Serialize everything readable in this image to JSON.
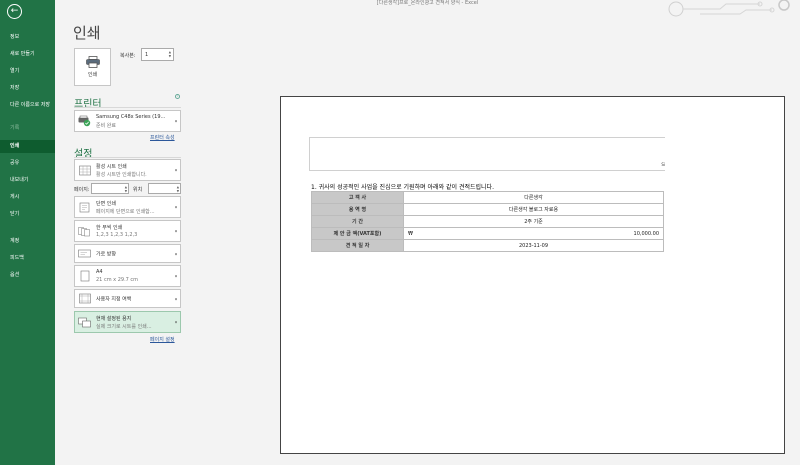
{
  "window": {
    "title": "[다른생각]프로_온라인광고 견적서 양식 - Excel"
  },
  "sidebar": {
    "items": [
      {
        "label": "정보",
        "state": "normal"
      },
      {
        "label": "새로 만들기",
        "state": "normal"
      },
      {
        "label": "열기",
        "state": "normal"
      },
      {
        "label": "저장",
        "state": "normal"
      },
      {
        "label": "다른 이름으로 저장",
        "state": "normal"
      },
      {
        "label": "기록",
        "state": "disabled"
      },
      {
        "label": "인쇄",
        "state": "active"
      },
      {
        "label": "공유",
        "state": "normal"
      },
      {
        "label": "내보내기",
        "state": "normal"
      },
      {
        "label": "게시",
        "state": "normal"
      },
      {
        "label": "닫기",
        "state": "normal"
      },
      {
        "label": "계정",
        "state": "normal"
      },
      {
        "label": "피드백",
        "state": "normal"
      },
      {
        "label": "옵션",
        "state": "normal"
      }
    ]
  },
  "print": {
    "title": "인쇄",
    "button_label": "인쇄",
    "copies_label": "복사본:",
    "copies_value": "1"
  },
  "printer": {
    "heading": "프린터",
    "name": "Samsung C48x Series (19...",
    "status": "준비 완료",
    "properties_link": "프린터 속성"
  },
  "settings": {
    "heading": "설정",
    "active_sheet": {
      "line1": "활성 시트 인쇄",
      "line2": "활성 시트만 인쇄합니다."
    },
    "pages_label": "페이지:",
    "to_label": "위치",
    "single_side": {
      "line1": "단면 인쇄",
      "line2": "페이지에 단면으로 인쇄합..."
    },
    "collated": {
      "line1": "한 부씩 인쇄",
      "line2": "1,2,3    1,2,3    1,2,3"
    },
    "orientation": {
      "line1": "가로 방향"
    },
    "paper": {
      "line1": "A4",
      "line2": "21 cm x 29.7 cm"
    },
    "margins": {
      "line1": "사용자 지정 여백"
    },
    "scaling": {
      "line1": "현재 설정된 용지",
      "line2": "실제 크기로 시트를 인쇄..."
    },
    "page_setup_link": "페이지 설정"
  },
  "preview": {
    "header_fragment": "Si",
    "statement": "1. 귀사의 성공적인 사업을 진심으로 기원하며 아래와 같이 견적드립니다.",
    "rows": [
      {
        "label": "고 객 사",
        "value": "다른생각"
      },
      {
        "label": "용 역 명",
        "value": "다른생각 블로그 자료용"
      },
      {
        "label": "기        간",
        "value": "2주 기준"
      },
      {
        "label": "제 안 금 액(VAT포함)",
        "currency": "₩",
        "amount": "10,000.00"
      },
      {
        "label": "견 적 일 자",
        "value": "2023-11-09"
      }
    ]
  }
}
